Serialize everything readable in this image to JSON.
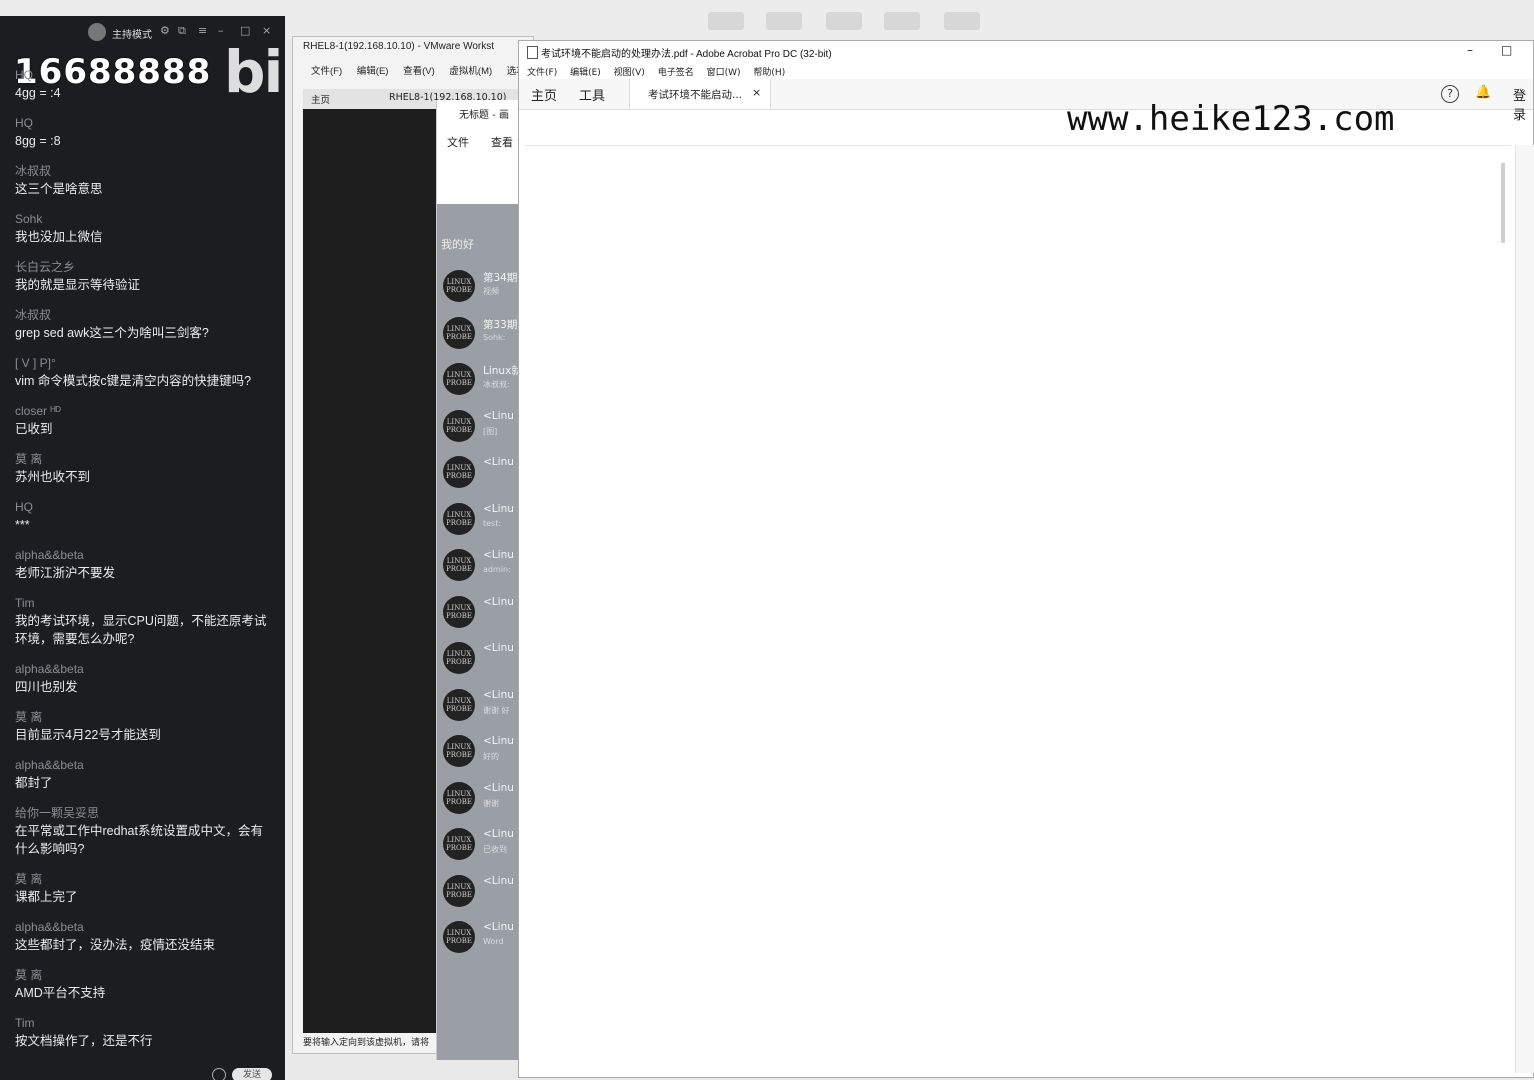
{
  "chat": {
    "mode_label": "主持模式",
    "room_id": "16688888",
    "platform_logo": "bili",
    "send_label": "发送",
    "messages": [
      {
        "user": "HQ",
        "text": "4gg = :4"
      },
      {
        "user": "HQ",
        "text": "8gg = :8"
      },
      {
        "user": "冰叔叔",
        "text": "这三个是啥意思"
      },
      {
        "user": "Sohk",
        "text": "我也没加上微信"
      },
      {
        "user": "长白云之乡",
        "text": "我的就是显示等待验证"
      },
      {
        "user": "冰叔叔",
        "text": "grep  sed    awk这三个为啥叫三剑客?"
      },
      {
        "user": "[    V    ]    P]°",
        "text": "vim 命令模式按c键是清空内容的快捷键吗?"
      },
      {
        "user": "closer ᴴᴰ",
        "text": "已收到"
      },
      {
        "user": "莫 离",
        "text": "苏州也收不到"
      },
      {
        "user": "HQ",
        "text": "***"
      },
      {
        "user": "alpha&&beta",
        "text": "老师江浙沪不要发"
      },
      {
        "user": "Tim",
        "text": "我的考试环境，显示CPU问题，不能还原考试环境，需要怎么办呢?",
        "tall": true
      },
      {
        "user": "alpha&&beta",
        "text": "四川也别发"
      },
      {
        "user": "莫 离",
        "text": "目前显示4月22号才能送到"
      },
      {
        "user": "alpha&&beta",
        "text": "都封了"
      },
      {
        "user": "给你一颗吴妥思",
        "text": "在平常或工作中redhat系统设置成中文，会有什么影响吗?",
        "tall": true
      },
      {
        "user": "莫 离",
        "text": "课都上完了"
      },
      {
        "user": "alpha&&beta",
        "text": "这些都封了，没办法，疫情还没结束"
      },
      {
        "user": "莫 离",
        "text": "AMD平台不支持"
      },
      {
        "user": "Tim",
        "text": "按文档操作了，还是不行"
      }
    ]
  },
  "vmware": {
    "title": "RHEL8-1(192.168.10.10) - VMware Workst",
    "menu": [
      "文件(F)",
      "编辑(E)",
      "查看(V)",
      "虚拟机(M)",
      "选项"
    ],
    "tab_home": "主页",
    "tab_vm": "RHEL8-1(192.168.10.10)",
    "status": "要将输入定向到该虚拟机，请将"
  },
  "explorer": {
    "title": "无标题 - 画",
    "menu_file": "文件",
    "menu_view": "查看",
    "group_label": "我的好",
    "items": [
      {
        "name": "第34期",
        "sub": "视频"
      },
      {
        "name": "第33期",
        "sub": "Sohk:"
      },
      {
        "name": "Linux就",
        "sub": "冰叔叔:"
      },
      {
        "name": "<Linu",
        "sub": "[图]"
      },
      {
        "name": "<Linu",
        "sub": ""
      },
      {
        "name": "<Linu",
        "sub": "test:"
      },
      {
        "name": "<Linu",
        "sub": "admin:"
      },
      {
        "name": "<Linu",
        "sub": ""
      },
      {
        "name": "<Linu",
        "sub": ""
      },
      {
        "name": "<Linu",
        "sub": "谢谢 好"
      },
      {
        "name": "<Linu",
        "sub": "好的"
      },
      {
        "name": "<Linu",
        "sub": "谢谢"
      },
      {
        "name": "<Linu",
        "sub": "已收到"
      },
      {
        "name": "<Linu",
        "sub": ""
      },
      {
        "name": "<Linu",
        "sub": "Word"
      }
    ]
  },
  "acrobat": {
    "title": "考试环境不能启动的处理办法.pdf - Adobe Acrobat Pro DC (32-bit)",
    "menu": [
      "文件(F)",
      "编辑(E)",
      "视图(V)",
      "电子签名",
      "窗口(W)",
      "帮助(H)"
    ],
    "tab_home": "主页",
    "tab_tools": "工具",
    "doc_tab": "考试环境不能启动...",
    "login": "登录",
    "watermark": "www.heike123.com"
  }
}
